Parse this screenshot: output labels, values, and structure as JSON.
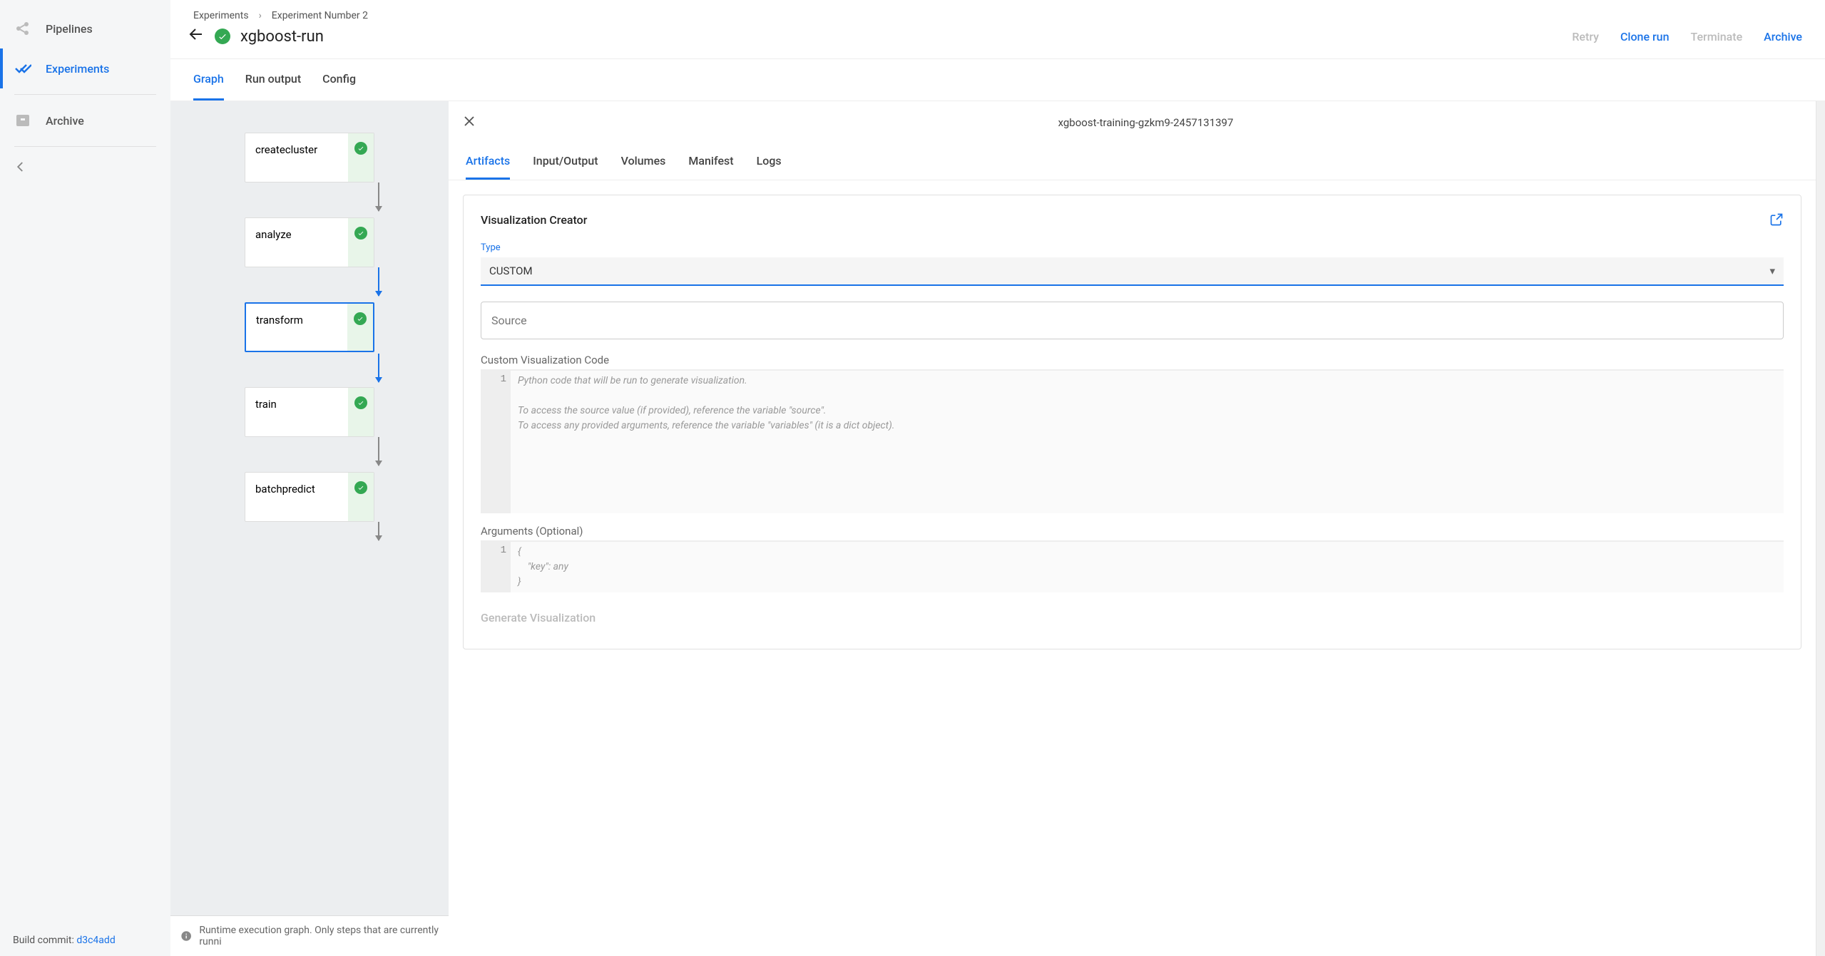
{
  "sidebar": {
    "items": [
      {
        "label": "Pipelines"
      },
      {
        "label": "Experiments"
      },
      {
        "label": "Archive"
      }
    ],
    "build_prefix": "Build commit: ",
    "build_hash": "d3c4add"
  },
  "breadcrumb": [
    "Experiments",
    "Experiment Number 2"
  ],
  "run_title": "xgboost-run",
  "actions": [
    {
      "label": "Retry",
      "enabled": false
    },
    {
      "label": "Clone run",
      "enabled": true
    },
    {
      "label": "Terminate",
      "enabled": false
    },
    {
      "label": "Archive",
      "enabled": true
    }
  ],
  "tabs": [
    "Graph",
    "Run output",
    "Config"
  ],
  "graph": {
    "nodes": [
      {
        "label": "createcluster"
      },
      {
        "label": "analyze"
      },
      {
        "label": "transform"
      },
      {
        "label": "train"
      },
      {
        "label": "batchpredict"
      }
    ],
    "footer": "Runtime execution graph. Only steps that are currently runni"
  },
  "detail": {
    "node_id": "xgboost-training-gzkm9-2457131397",
    "tabs": [
      "Artifacts",
      "Input/Output",
      "Volumes",
      "Manifest",
      "Logs"
    ],
    "card_title": "Visualization Creator",
    "type_label": "Type",
    "type_value": "CUSTOM",
    "source_placeholder": "Source",
    "code_label": "Custom Visualization Code",
    "code_placeholder": "Python code that will be run to generate visualization.\n\nTo access the source value (if provided), reference the variable \"source\".\nTo access any provided arguments, reference the variable \"variables\" (it is a dict object).",
    "args_label": "Arguments (Optional)",
    "args_placeholder": "{\n    \"key\": any\n}",
    "generate_label": "Generate Visualization"
  }
}
